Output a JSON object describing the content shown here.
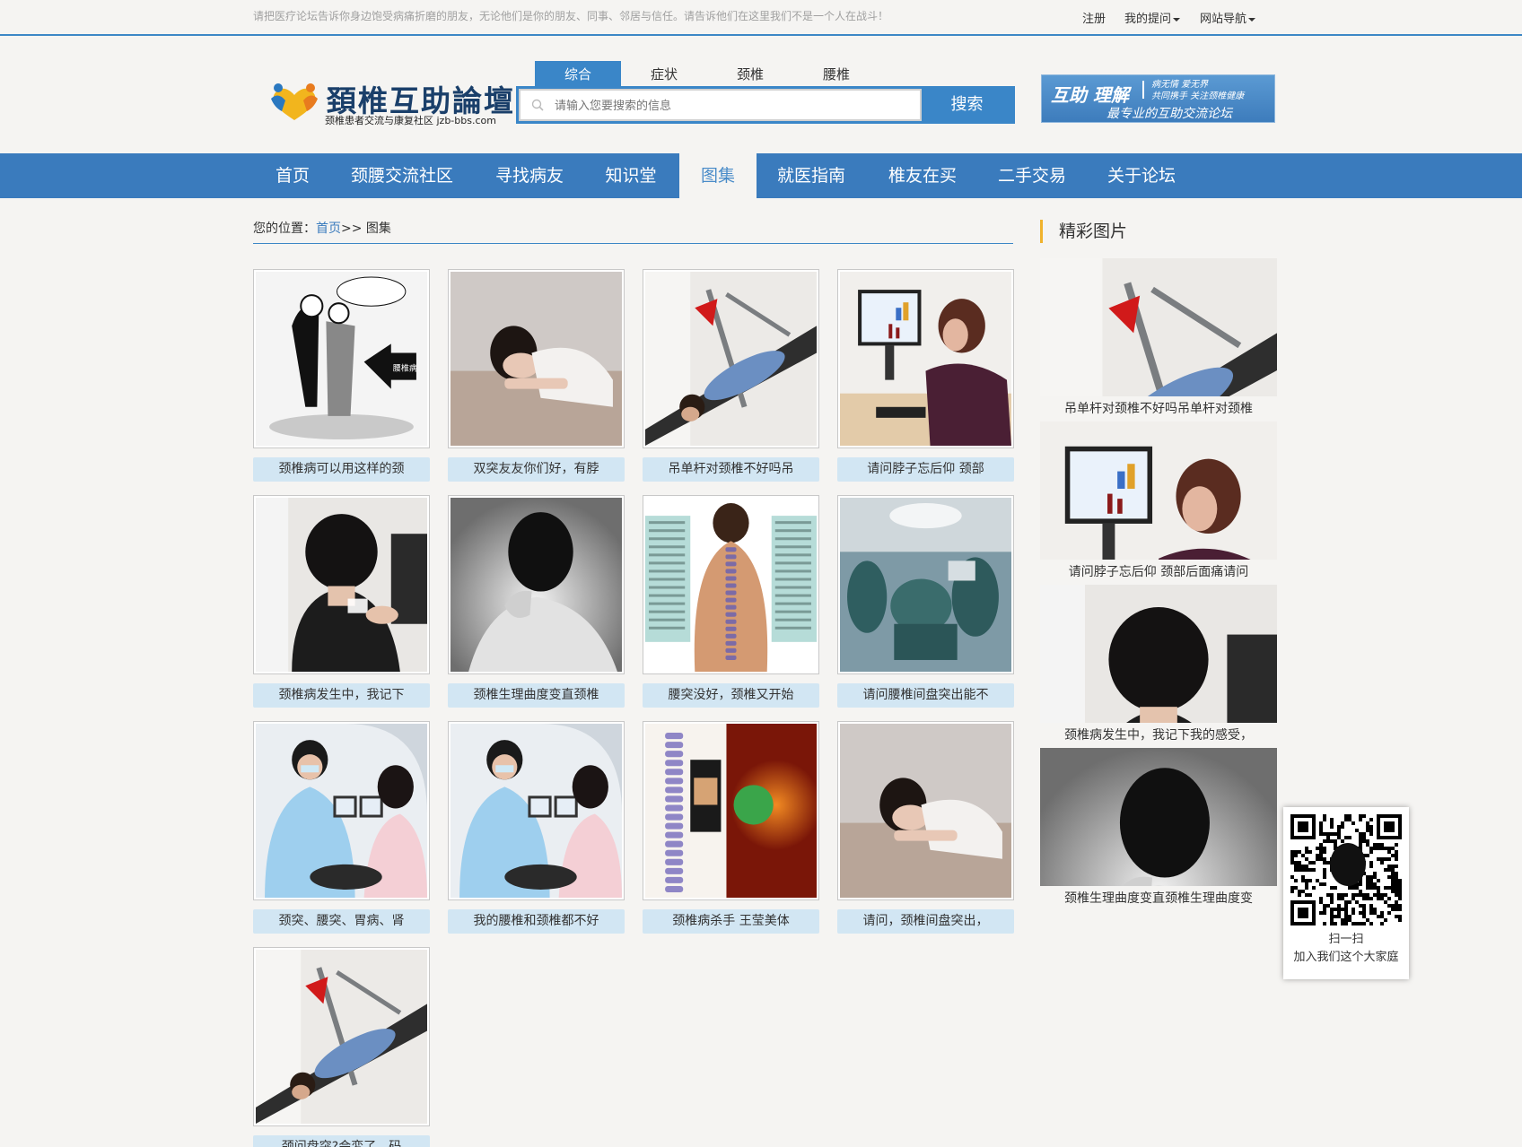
{
  "topbar": {
    "tip": "请把医疗论坛告诉你身边饱受病痛折磨的朋友，无论他们是你的朋友、同事、邻居与信任。请告诉他们在这里我们不是一个人在战斗！",
    "register": "注册",
    "my_questions": "我的提问",
    "site_nav": "网站导航"
  },
  "logo": {
    "name": "頚椎互助論壇",
    "subtitle": "颈椎患者交流与康复社区 jzb-bbs.com"
  },
  "search": {
    "tabs": [
      "综合",
      "症状",
      "颈椎",
      "腰椎"
    ],
    "active_tab": "综合",
    "placeholder": "请输入您要搜索的信息",
    "button": "搜索"
  },
  "banner": {
    "main": "互助 理解",
    "slogan1": "病无情 爱无界",
    "slogan2": "共同携手 关注颈椎健康",
    "tagline": "最专业的互助交流论坛"
  },
  "nav": {
    "items": [
      "首页",
      "颈腰交流社区",
      "寻找病友",
      "知识堂",
      "图集",
      "就医指南",
      "椎友在买",
      "二手交易",
      "关于论坛"
    ],
    "active": "图集"
  },
  "breadcrumb": {
    "prefix": "您的位置：",
    "home": "首页",
    "sep": ">> ",
    "current": "图集"
  },
  "gallery": [
    {
      "caption": "颈椎病可以用这样的颈",
      "image": "cartoon-couple"
    },
    {
      "caption": "双突友友你们好，有脖",
      "image": "sleeping-woman"
    },
    {
      "caption": "吊单杆对颈椎不好吗吊",
      "image": "traction-bed"
    },
    {
      "caption": "请问脖子忘后仰 颈部",
      "image": "woman-computer"
    },
    {
      "caption": "颈椎病发生中，我记下",
      "image": "neck-treatment"
    },
    {
      "caption": "颈椎生理曲度变直颈椎",
      "image": "bw-neck"
    },
    {
      "caption": "腰突没好，颈椎又开始",
      "image": "spine-chart"
    },
    {
      "caption": "请问腰椎间盘突出能不",
      "image": "surgery-room"
    },
    {
      "caption": "颈突、腰突、胃病、肾",
      "image": "ultrasound"
    },
    {
      "caption": "我的腰椎和颈椎都不好",
      "image": "ultrasound"
    },
    {
      "caption": "颈椎病杀手 王莹美体",
      "image": "spine-poster"
    },
    {
      "caption": "请问，颈椎间盘突出，",
      "image": "sleeping-woman"
    },
    {
      "caption": "颈问盘突?会変了，码",
      "image": "traction-bed"
    }
  ],
  "sidebar": {
    "title": "精彩图片",
    "items": [
      {
        "caption": "吊单杆对颈椎不好吗吊单杆对颈椎",
        "image": "traction-bed"
      },
      {
        "caption": "请问脖子忘后仰 颈部后面痛请问",
        "image": "woman-computer"
      },
      {
        "caption": "颈椎病发生中，我记下我的感受，",
        "image": "neck-treatment"
      },
      {
        "caption": "颈椎生理曲度变直颈椎生理曲度变",
        "image": "bw-neck"
      }
    ]
  },
  "qr": {
    "line1": "扫一扫",
    "line2": "加入我们这个大家庭"
  },
  "colors": {
    "primary": "#3a7bbd",
    "caption_bg": "#d2e6f3",
    "accent": "#f0b22c"
  }
}
